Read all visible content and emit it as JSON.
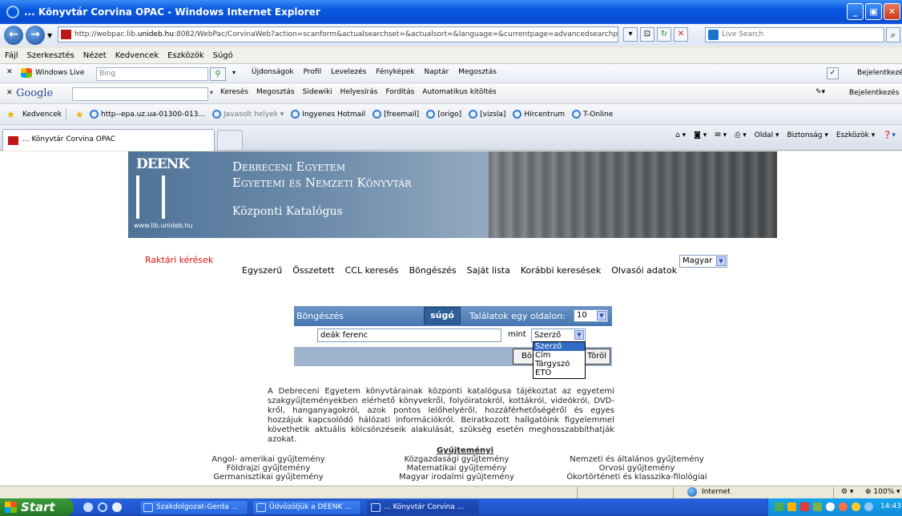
{
  "window": {
    "title": "... Könyvtár Corvina OPAC - Windows Internet Explorer"
  },
  "address": {
    "url_prefix": "http://webpac.lib.",
    "url_host": "unideb.hu",
    "url_rest": ":8082/WebPac/CorvinaWeb?action=scanform&actualsearchset=&actualsort=&language=&currentpage=advancedsearchpage",
    "live_search_placeholder": "Live Search"
  },
  "menu": [
    "Fájl",
    "Szerkesztés",
    "Nézet",
    "Kedvencek",
    "Eszközök",
    "Súgó"
  ],
  "wl_toolbar": {
    "brand": "Windows Live",
    "bing_placeholder": "Bing",
    "items": [
      "Újdonságok",
      "Profil",
      "Levelezés",
      "Fényképek",
      "Naptár",
      "Megosztás"
    ],
    "signin": "Bejelentkezés"
  },
  "google_toolbar": {
    "brand": "Google",
    "items": [
      "Keresés",
      "Megosztás",
      "Sidewiki",
      "Helyesírás",
      "Fordítás",
      "Automatikus kitöltés"
    ],
    "signin": "Bejelentkezés"
  },
  "favorites": {
    "label": "Kedvencek",
    "items": [
      "http--epa.uz.ua-01300-013...",
      "Javasolt helyek",
      "Ingyenes Hotmail",
      "[freemail]",
      "[origo]",
      "[vizsla]",
      "Hírcentrum",
      "T-Online"
    ]
  },
  "tab": {
    "title": "... Könyvtár Corvina OPAC"
  },
  "command_bar": [
    "Oldal",
    "Biztonság",
    "Eszközök"
  ],
  "banner": {
    "logo": "DEENK",
    "website": "www.lib.unideb.hu",
    "line1": "Debreceni Egyetem",
    "line2": "Egyetemi és Nemzeti Könyvtár",
    "subtitle": "Központi Katalógus"
  },
  "nav": {
    "raktari": "Raktári kérések",
    "items": [
      "Egyszerű",
      "Összetett",
      "CCL keresés",
      "Böngészés",
      "Saját lista",
      "Korábbi keresések",
      "Olvasói adatok"
    ],
    "language": "Magyar"
  },
  "search": {
    "header": "Böngészés",
    "help": "súgó",
    "per_page_label": "Találatok egy oldalon:",
    "per_page_value": "10",
    "query": "deák ferenc",
    "mint": "mint",
    "field_value": "Szerző",
    "field_options": [
      "Szerző",
      "Cím",
      "Tárgyszó",
      "ETO"
    ],
    "browse_button": "Böngészés",
    "clear_button": "Töröl"
  },
  "description": "A Debreceni Egyetem könyvtárainak központi katalógusa tájékoztat az egyetemi szakgyűjteményekben elérhető könyvekről, folyóiratokról, kottákról, videókról, DVD-kről, hanganyagokról, azok pontos lelőhelyéről, hozzáférhetőségéről és egyes hozzájuk kapcsolódó hálózati információkról. Beiratkozott hallgatóink figyelemmel követhetik aktuális kölcsönzéseik alakulását, szükség esetén meghosszabbíthatják azokat.",
  "collections": {
    "title": "Gyűjteményi",
    "col1": [
      "Angol- amerikai gyűjtemény",
      "Földrajzi gyűjtemény",
      "Germanisztikai gyűjtemény"
    ],
    "col2": [
      "Közgazdasági gyűjtemény",
      "Matematikai gyűjtemény",
      "Magyar irodalmi gyűjtemény"
    ],
    "col3": [
      "Nemzeti és általános gyűjtemény",
      "Orvosi gyűjtemény",
      "Ókortörténeti és klasszika-filológiai"
    ]
  },
  "status": {
    "zone": "Internet",
    "zoom": "100%"
  },
  "taskbar": {
    "start": "Start",
    "tasks": [
      "Szakdolgozat-Gerda ...",
      "Üdvözöljük a DEENK ...",
      "... Könyvtár Corvina ..."
    ],
    "time": "14:43"
  }
}
